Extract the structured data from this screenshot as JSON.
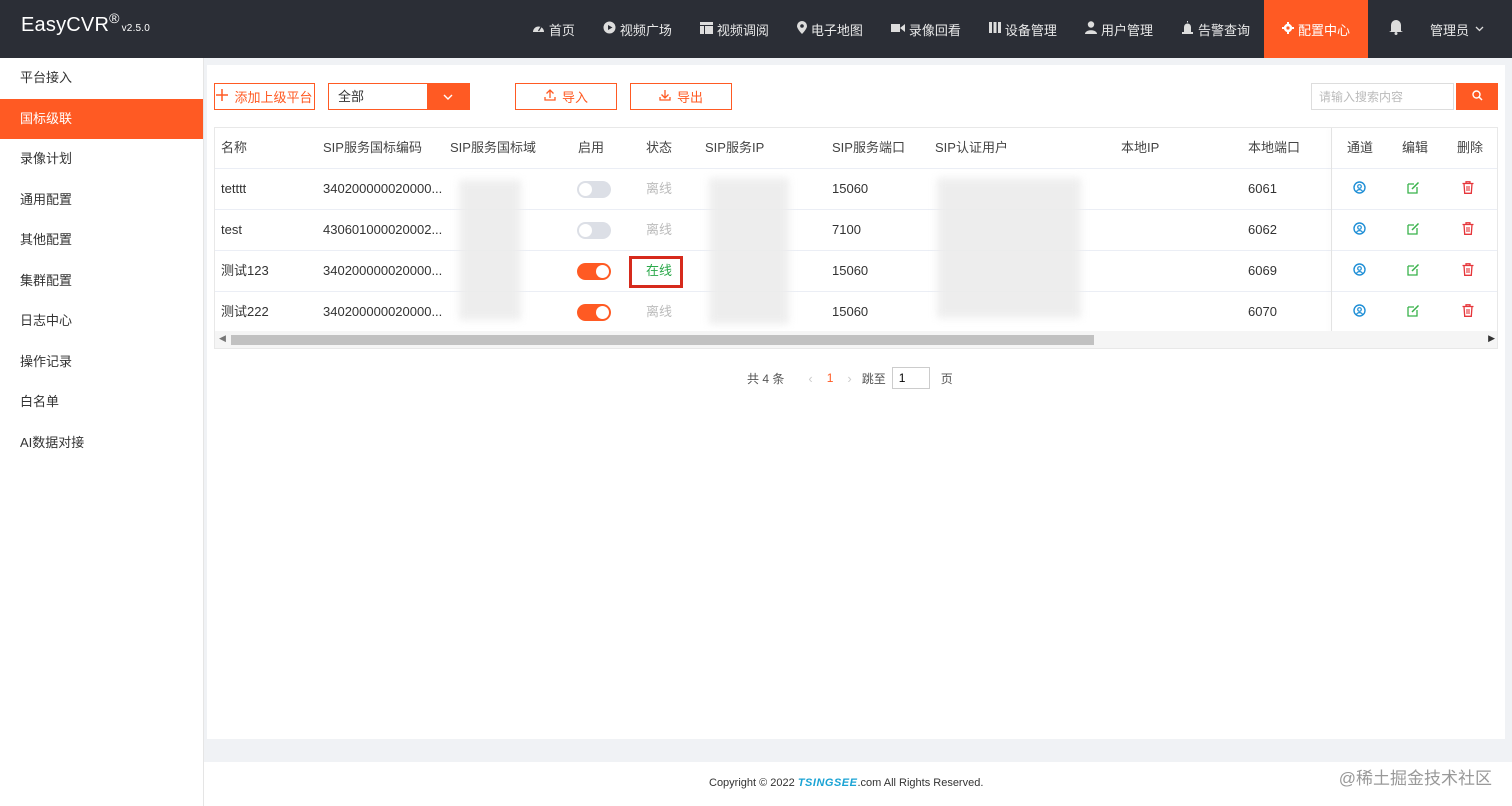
{
  "app": {
    "name": "EasyCVR",
    "reg": "®",
    "version": "v2.5.0"
  },
  "nav": {
    "items": [
      {
        "label": "首页",
        "icon": "dashboard-icon"
      },
      {
        "label": "视频广场",
        "icon": "play-circle-icon"
      },
      {
        "label": "视频调阅",
        "icon": "grid-icon"
      },
      {
        "label": "电子地图",
        "icon": "map-pin-icon"
      },
      {
        "label": "录像回看",
        "icon": "video-camera-icon"
      },
      {
        "label": "设备管理",
        "icon": "devices-icon"
      },
      {
        "label": "用户管理",
        "icon": "user-icon"
      },
      {
        "label": "告警查询",
        "icon": "alarm-icon"
      },
      {
        "label": "配置中心",
        "icon": "gear-icon",
        "active": true
      }
    ],
    "user": "管理员"
  },
  "sidebar": {
    "items": [
      {
        "label": "平台接入"
      },
      {
        "label": "国标级联",
        "active": true
      },
      {
        "label": "录像计划"
      },
      {
        "label": "通用配置"
      },
      {
        "label": "其他配置"
      },
      {
        "label": "集群配置"
      },
      {
        "label": "日志中心"
      },
      {
        "label": "操作记录"
      },
      {
        "label": "白名单"
      },
      {
        "label": "AI数据对接"
      }
    ]
  },
  "toolbar": {
    "add_label": "添加上级平台",
    "filter_value": "全部",
    "import_label": "导入",
    "export_label": "导出",
    "search_placeholder": "请输入搜索内容"
  },
  "table": {
    "headers": {
      "name": "名称",
      "sip_code": "SIP服务国标编码",
      "sip_domain": "SIP服务国标域",
      "enabled": "启用",
      "status": "状态",
      "sip_ip": "SIP服务IP",
      "sip_port": "SIP服务端口",
      "sip_user": "SIP认证用户",
      "local_ip": "本地IP",
      "local_port": "本地端口",
      "channel": "通道",
      "edit": "编辑",
      "delete": "删除"
    },
    "rows": [
      {
        "name": "tetttt",
        "sip_code": "340200000020000...",
        "enabled": false,
        "status": "离线",
        "online": false,
        "sip_port": "15060",
        "local_port": "6061"
      },
      {
        "name": "test",
        "sip_code": "430601000020002...",
        "enabled": false,
        "status": "离线",
        "online": false,
        "sip_port": "7100",
        "local_port": "6062"
      },
      {
        "name": "测试123",
        "sip_code": "340200000020000...",
        "enabled": true,
        "status": "在线",
        "online": true,
        "sip_port": "15060",
        "local_port": "6069"
      },
      {
        "name": "测试222",
        "sip_code": "340200000020000...",
        "enabled": true,
        "status": "离线",
        "online": false,
        "sip_port": "15060",
        "local_port": "6070"
      }
    ]
  },
  "pagination": {
    "total_text": "共 4 条",
    "current_page": "1",
    "jump_label": "跳至",
    "jump_value": "1",
    "page_suffix": "页"
  },
  "footer": {
    "prefix": "Copyright © 2022 ",
    "brand": "TSINGSEE",
    "suffix": ".com All Rights Reserved."
  },
  "watermark": "@稀土掘金技术社区",
  "colors": {
    "accent": "#ff5a23",
    "topbar": "#2b2e36",
    "online": "#2aa84a",
    "highlight": "#d62a1c"
  }
}
